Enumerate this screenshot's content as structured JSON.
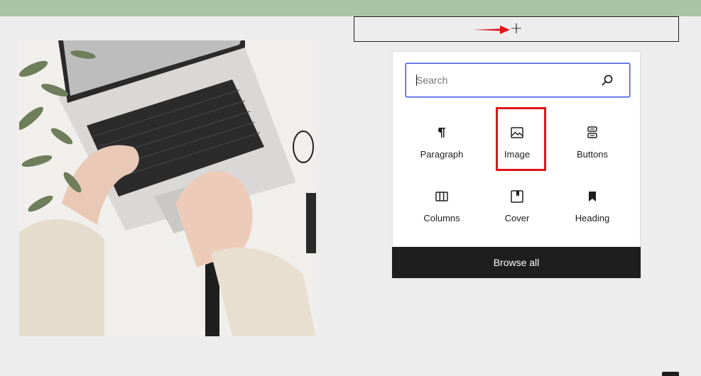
{
  "add_block": {
    "icon": "plus-icon",
    "label": "+"
  },
  "search": {
    "placeholder": "Search",
    "value": "",
    "icon": "search-icon"
  },
  "blocks": [
    {
      "label": "Paragraph",
      "icon": "paragraph-icon"
    },
    {
      "label": "Image",
      "icon": "image-icon"
    },
    {
      "label": "Buttons",
      "icon": "buttons-icon"
    },
    {
      "label": "Columns",
      "icon": "columns-icon"
    },
    {
      "label": "Cover",
      "icon": "cover-icon"
    },
    {
      "label": "Heading",
      "icon": "bookmark-icon"
    }
  ],
  "browse_all": {
    "label": "Browse all"
  },
  "colors": {
    "accent_blue": "#3858e9",
    "highlight_red": "#e0141a",
    "dark": "#1e1e1e",
    "top_band": "#a9c4a4"
  }
}
